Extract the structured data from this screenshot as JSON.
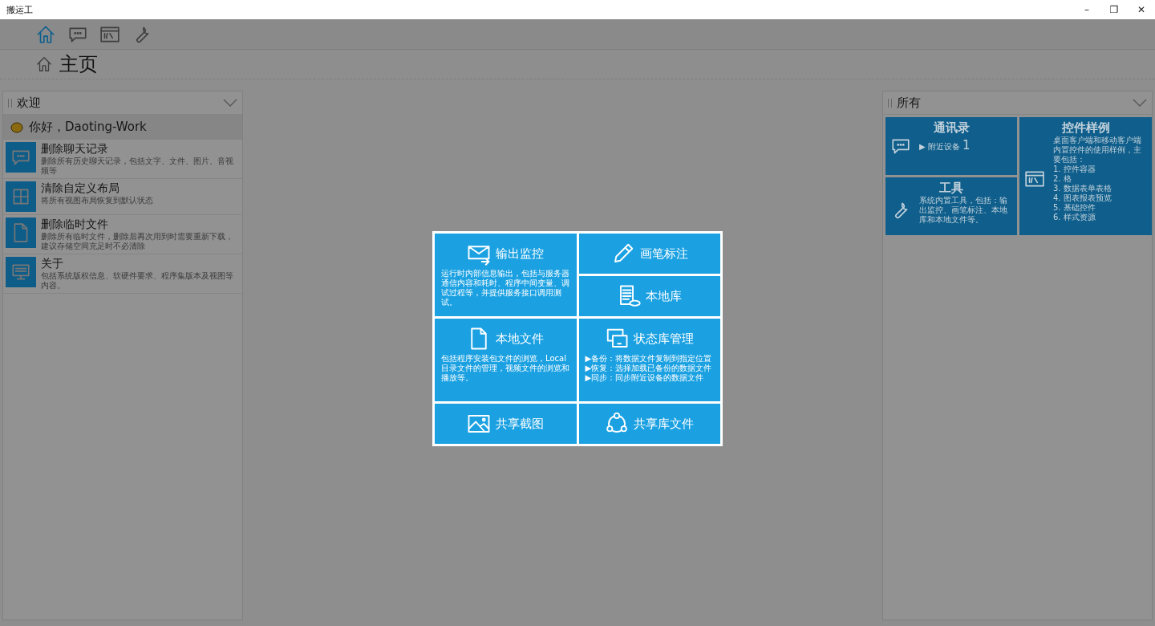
{
  "window": {
    "title": "搬运工",
    "controls": [
      "–",
      "❐",
      "✕"
    ]
  },
  "toolbar": [
    {
      "selected": true
    },
    {
      "selected": false
    },
    {
      "selected": false
    },
    {
      "selected": false
    }
  ],
  "page_title": "主页",
  "left_panel": {
    "title": "欢迎",
    "greeting": "你好，Daoting-Work",
    "items": [
      {
        "title": "删除聊天记录",
        "description": "删除所有历史聊天记录，包括文字、文件、图片、音视频等"
      },
      {
        "title": "清除自定义布局",
        "description": "将所有视图布局恢复到默认状态"
      },
      {
        "title": "删除临时文件",
        "description": "删除所有临时文件，删除后再次用到时需要重新下载，建议存储空间充足时不必清除"
      },
      {
        "title": "关于",
        "description": "包括系统版权信息、软硬件要求、程序集版本及视图等内容。"
      }
    ]
  },
  "right_panel": {
    "title": "所有",
    "tiles": [
      {
        "title": "通讯录",
        "link": "▶ 附近设备",
        "count": "1"
      },
      {
        "title": "工具",
        "description": "系统内置工具，包括：输出监控、画笔标注、本地库和本地文件等。"
      },
      {
        "title": "控件样例",
        "description": "桌面客户端和移动客户端内置控件的使用样例，主要包括：",
        "lines": [
          "1. 控件容器",
          "2. 格",
          "3. 数据表单表格",
          "4. 图表报表预览",
          "5. 基础控件",
          "6. 样式资源"
        ]
      }
    ]
  },
  "popup": {
    "tiles": [
      {
        "kind": "large",
        "title": "输出监控",
        "description": "运行时内部信息输出，包括与服务器通信内容和耗时、程序中间变量、调试过程等，并提供服务接口调用测试。"
      },
      {
        "kind": "small",
        "title": "画笔标注"
      },
      {
        "kind": "small",
        "title": "本地库"
      },
      {
        "kind": "large",
        "title": "本地文件",
        "description": "包括程序安装包文件的浏览，Local目录文件的管理，视频文件的浏览和播放等。"
      },
      {
        "kind": "large",
        "title": "状态库管理",
        "lines": [
          "▶备份：将数据文件复制到指定位置",
          "▶恢复：选择加载已备份的数据文件",
          "▶同步：同步附近设备的数据文件"
        ]
      },
      {
        "kind": "small",
        "title": "共享截图"
      },
      {
        "kind": "small",
        "title": "共享库文件"
      }
    ]
  }
}
